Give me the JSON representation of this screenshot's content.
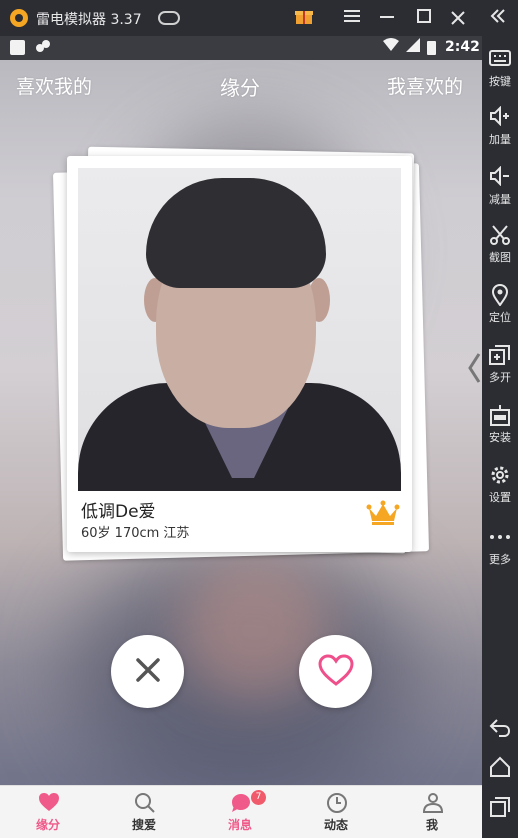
{
  "window": {
    "title": "雷电模拟器 3.37"
  },
  "statusbar": {
    "time": "2:42"
  },
  "top_tabs": {
    "left": "喜欢我的",
    "center": "缘分",
    "right": "我喜欢的"
  },
  "card": {
    "name": "低调De爱",
    "info": "60岁 170cm 江苏",
    "vip_icon": "crown-icon"
  },
  "actions": {
    "dislike_icon": "close-icon",
    "like_icon": "heart-icon"
  },
  "bottom_nav": {
    "items": [
      {
        "label": "缘分",
        "icon": "heart-icon",
        "active": true
      },
      {
        "label": "搜爱",
        "icon": "search-icon",
        "active": false
      },
      {
        "label": "消息",
        "icon": "chat-bubble-icon",
        "active": false,
        "badge": "7"
      },
      {
        "label": "动态",
        "icon": "clock-icon",
        "active": false
      },
      {
        "label": "我",
        "icon": "person-icon",
        "active": false
      }
    ]
  },
  "sidebar": {
    "items": [
      {
        "label": "按键",
        "icon": "keyboard-icon"
      },
      {
        "label": "加量",
        "icon": "volume-up-icon"
      },
      {
        "label": "减量",
        "icon": "volume-down-icon"
      },
      {
        "label": "截图",
        "icon": "scissors-icon"
      },
      {
        "label": "定位",
        "icon": "location-pin-icon"
      },
      {
        "label": "多开",
        "icon": "multi-window-icon"
      },
      {
        "label": "安装",
        "icon": "apk-install-icon"
      },
      {
        "label": "设置",
        "icon": "gear-icon"
      },
      {
        "label": "更多",
        "icon": "more-dots-icon"
      }
    ]
  },
  "colors": {
    "accent": "#f05a8a",
    "vip_gold": "#f5a623",
    "emulator_chrome": "#2b2d33"
  }
}
